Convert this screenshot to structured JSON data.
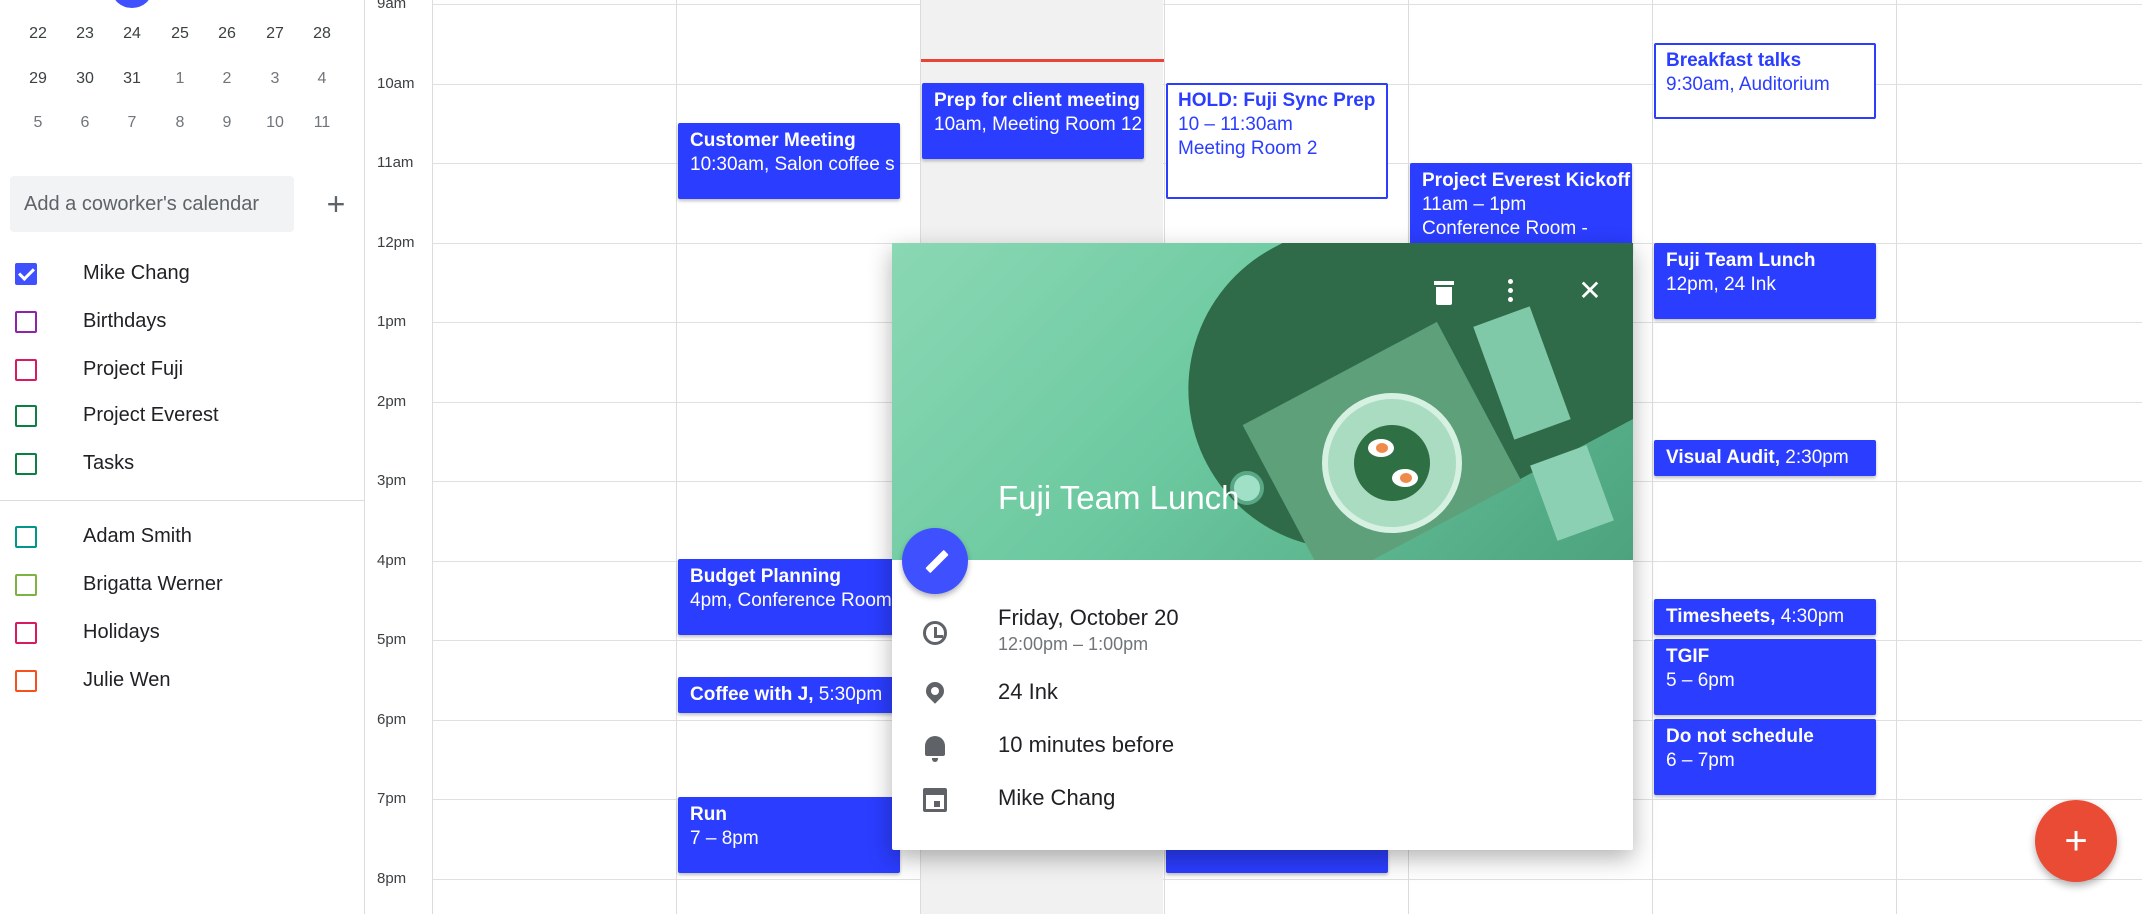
{
  "mini_calendar": {
    "rows": [
      [
        {
          "d": "22",
          "dim": false
        },
        {
          "d": "23",
          "dim": false
        },
        {
          "d": "24",
          "dim": false
        },
        {
          "d": "25",
          "dim": false
        },
        {
          "d": "26",
          "dim": false
        },
        {
          "d": "27",
          "dim": false
        },
        {
          "d": "28",
          "dim": false
        }
      ],
      [
        {
          "d": "29",
          "dim": false
        },
        {
          "d": "30",
          "dim": false
        },
        {
          "d": "31",
          "dim": false
        },
        {
          "d": "1",
          "dim": true
        },
        {
          "d": "2",
          "dim": true
        },
        {
          "d": "3",
          "dim": true
        },
        {
          "d": "4",
          "dim": true
        }
      ],
      [
        {
          "d": "5",
          "dim": true
        },
        {
          "d": "6",
          "dim": true
        },
        {
          "d": "7",
          "dim": true
        },
        {
          "d": "8",
          "dim": true
        },
        {
          "d": "9",
          "dim": true
        },
        {
          "d": "10",
          "dim": true
        },
        {
          "d": "11",
          "dim": true
        }
      ]
    ]
  },
  "sidebar": {
    "add_coworker_placeholder": "Add a coworker's calendar",
    "add_icon": "+",
    "my_calendars": [
      {
        "label": "Mike Chang",
        "checked": true,
        "color": "#3f51ff"
      },
      {
        "label": "Birthdays",
        "checked": false,
        "color": "#8e24aa"
      },
      {
        "label": "Project Fuji",
        "checked": false,
        "color": "#d81b60"
      },
      {
        "label": "Project Everest",
        "checked": false,
        "color": "#0b8043"
      },
      {
        "label": "Tasks",
        "checked": false,
        "color": "#0b8043"
      }
    ],
    "other_calendars": [
      {
        "label": "Adam Smith",
        "checked": false,
        "color": "#009688"
      },
      {
        "label": "Brigatta Werner",
        "checked": false,
        "color": "#7cb342"
      },
      {
        "label": "Holidays",
        "checked": false,
        "color": "#d81b60"
      },
      {
        "label": "Julie Wen",
        "checked": false,
        "color": "#f4511e"
      }
    ]
  },
  "time_labels": [
    "9am",
    "10am",
    "11am",
    "12pm",
    "1pm",
    "2pm",
    "3pm",
    "4pm",
    "5pm",
    "6pm",
    "7pm",
    "8pm"
  ],
  "events": {
    "customer_meeting": {
      "title": "Customer Meeting",
      "detail": "10:30am, Salon coffee s"
    },
    "budget_planning": {
      "title": "Budget Planning",
      "detail": "4pm, Conference Room"
    },
    "coffee_with_j": {
      "title": "Coffee with J,",
      "detail": " 5:30pm"
    },
    "run": {
      "title": "Run",
      "detail": "7 – 8pm"
    },
    "prep_client": {
      "title": "Prep for client meeting",
      "detail": "10am, Meeting Room 12"
    },
    "hold_fuji": {
      "title": "HOLD: Fuji Sync Prep",
      "line2": "10 – 11:30am",
      "line3": "Meeting Room 2"
    },
    "everest": {
      "title": "Project Everest Kickoff",
      "line2": "11am – 1pm",
      "line3": "Conference Room -"
    },
    "breakfast": {
      "title": "Breakfast talks",
      "detail": "9:30am, Auditorium"
    },
    "fuji_lunch": {
      "title": "Fuji Team Lunch",
      "detail": "12pm, 24 Ink"
    },
    "visual_audit": {
      "title": "Visual Audit,",
      "detail": " 2:30pm"
    },
    "timesheets": {
      "title": "Timesheets,",
      "detail": " 4:30pm"
    },
    "tgif": {
      "title": "TGIF",
      "detail": "5 – 6pm"
    },
    "do_not_schedule": {
      "title": "Do not schedule",
      "detail": "6 – 7pm"
    }
  },
  "popup": {
    "title": "Fuji Team Lunch",
    "date": "Friday, October 20",
    "time": "12:00pm – 1:00pm",
    "location": "24 Ink",
    "reminder": "10 minutes before",
    "calendar": "Mike Chang",
    "close_icon": "✕"
  },
  "fab": {
    "label": "+"
  },
  "colors": {
    "accent": "#3f51ff",
    "event": "#2b3dff",
    "fab": "#e94b35",
    "now_line": "#ea4335"
  }
}
